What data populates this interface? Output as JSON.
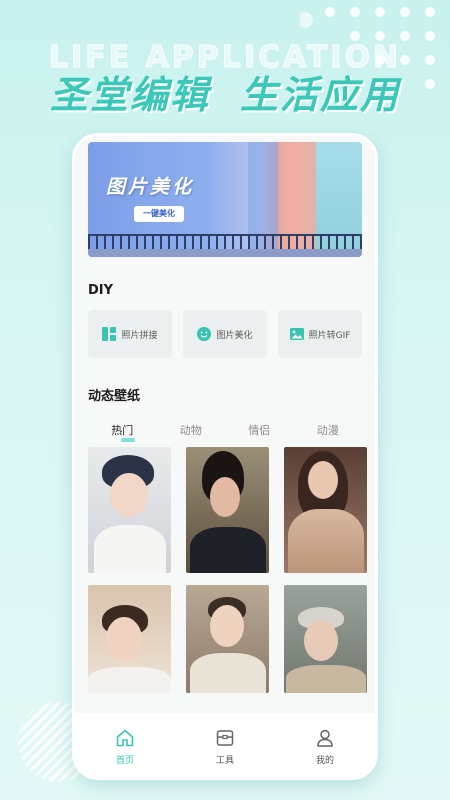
{
  "promo": {
    "watermark": "LIFE APPLICATION",
    "headline_left": "圣堂编辑",
    "headline_right": "生活应用"
  },
  "banner": {
    "title": "图片美化",
    "button_label": "一键美化"
  },
  "diy": {
    "title": "DIY",
    "items": [
      {
        "label": "照片拼接",
        "icon": "collage-icon"
      },
      {
        "label": "图片美化",
        "icon": "smiley-icon"
      },
      {
        "label": "照片转GIF",
        "icon": "image-icon"
      }
    ]
  },
  "wallpaper": {
    "title": "动态壁纸",
    "tabs": [
      {
        "label": "热门",
        "active": true
      },
      {
        "label": "动物",
        "active": false
      },
      {
        "label": "情侣",
        "active": false
      },
      {
        "label": "动漫",
        "active": false
      }
    ]
  },
  "tabbar": {
    "items": [
      {
        "label": "首页",
        "icon": "home-icon",
        "active": true
      },
      {
        "label": "工具",
        "icon": "toolbox-icon",
        "active": false
      },
      {
        "label": "我的",
        "icon": "user-icon",
        "active": false
      }
    ]
  },
  "colors": {
    "accent": "#38c3b2",
    "headline": "#3cc8b8",
    "background": "#c9f2ee"
  }
}
